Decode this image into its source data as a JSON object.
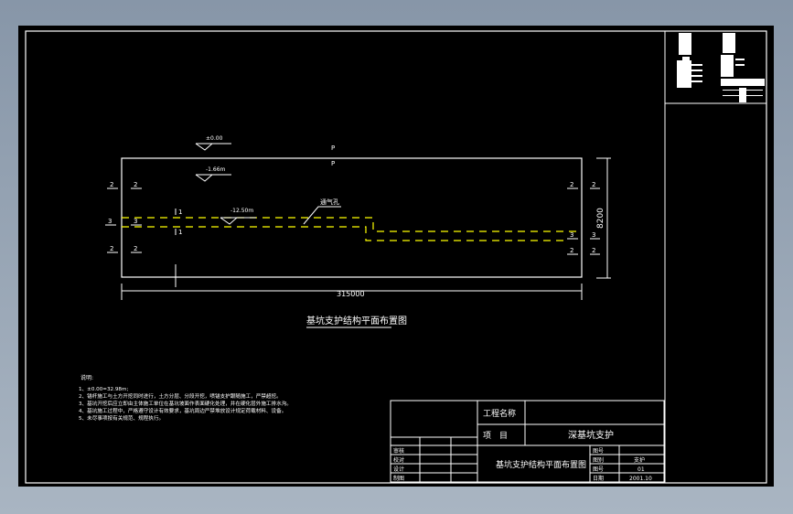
{
  "colors": {
    "background": "#000000",
    "lines": "#ffffff",
    "dashed_lines": "#ffff00",
    "viewer_background": "#8e9cad"
  },
  "drawing": {
    "title": "基坑支护结构平面布置图",
    "dimension_width": "315000",
    "dimension_height": "8200",
    "elevations": [
      "±0.00",
      "-1.66m",
      "-12.50m"
    ],
    "leader_label": "通气孔",
    "section_marks": {
      "two": "2",
      "three": "3",
      "one": "1",
      "p": "P"
    }
  },
  "notes": {
    "heading": "说明:",
    "items": [
      "1、±0.00=32.98m;",
      "2、锚杆施工与土方开挖同时进行，土方分层、分段开挖，喷锚支护跟随施工，严禁超挖。",
      "3、基坑开挖后应立即由主体施工单位在基坑坡面作表面硬化处理，并在硬化层外施工排水沟。",
      "4、基坑施工过程中，严格遵守设计有效要求，基坑周边严禁堆放设计规定荷载材料、设备。",
      "5、未尽事项按有关规范、规程执行。"
    ]
  },
  "title_block": {
    "project_name_label": "工程名称",
    "item_label": "项　目",
    "item_value": "深基坑支护",
    "drawing_name": "基坑支护结构平面布置图",
    "roles": [
      "审核",
      "校对",
      "设计",
      "制图"
    ],
    "fields": [
      {
        "label": "图号",
        "value": ""
      },
      {
        "label": "图别",
        "value": "支护"
      },
      {
        "label": "图号",
        "value": "01"
      },
      {
        "label": "日期",
        "value": "2001.10"
      }
    ]
  }
}
